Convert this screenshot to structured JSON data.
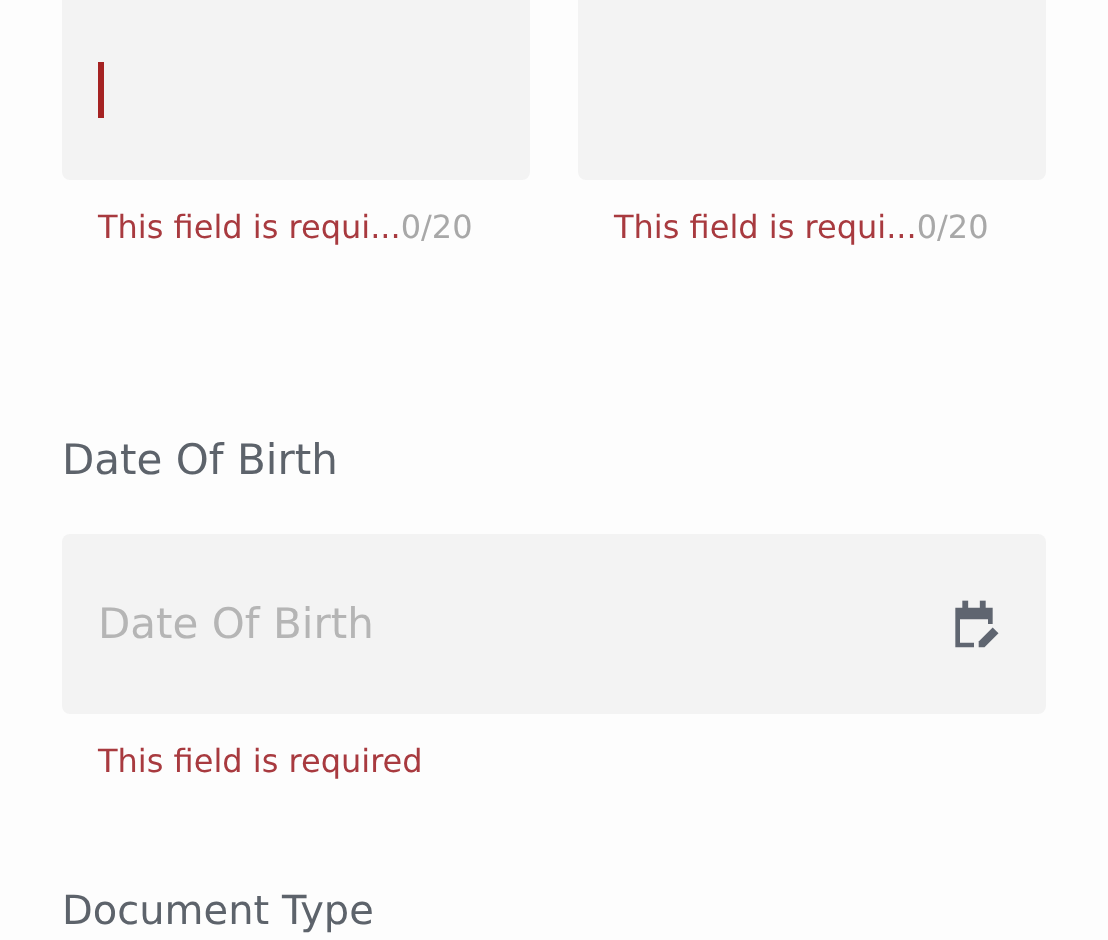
{
  "name_fields": [
    {
      "focused": true,
      "error": "This field is requi...",
      "counter": "0/20"
    },
    {
      "focused": false,
      "error": "This field is requi...",
      "counter": "0/20"
    }
  ],
  "date_of_birth": {
    "label": "Date Of Birth",
    "placeholder": "Date Of Birth",
    "error": "This field is required"
  },
  "next_section": {
    "label": "Document Type"
  }
}
